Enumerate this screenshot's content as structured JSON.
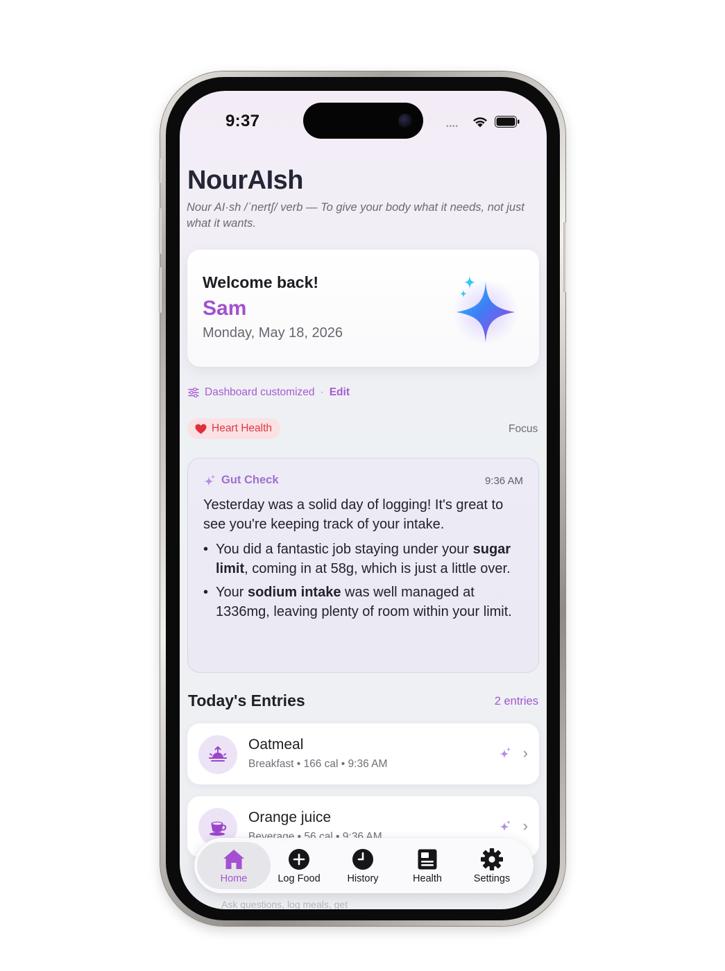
{
  "status_bar": {
    "time": "9:37",
    "signal": "••••",
    "icons": [
      "signal-icon",
      "wifi-icon",
      "battery-icon"
    ]
  },
  "header": {
    "title": "NourAIsh",
    "tagline": "Nour AI·sh /ˈnertʃ/ verb — To give your body what it needs, not just what it wants."
  },
  "welcome": {
    "greeting": "Welcome back!",
    "name": "Sam",
    "date": "Monday, May 18, 2026",
    "icon": "sparkle-icon"
  },
  "dashboard": {
    "status": "Dashboard customized",
    "separator": "·",
    "edit_label": "Edit"
  },
  "focus": {
    "chip_label": "Heart Health",
    "label": "Focus"
  },
  "gut_check": {
    "title": "Gut Check",
    "time": "9:36 AM",
    "intro": "Yesterday was a solid day of logging! It's great to see you're keeping track of your intake.",
    "bullets": [
      {
        "pre": "You did a fantastic job staying under your ",
        "bold": "sugar limit",
        "post": ", coming in at 58g, which is just a little over."
      },
      {
        "pre": "Your ",
        "bold": "sodium intake",
        "post": " was well managed at 1336mg, leaving plenty of room within your limit."
      }
    ]
  },
  "entries": {
    "title": "Today's Entries",
    "count": "2 entries",
    "items": [
      {
        "name": "Oatmeal",
        "meta": "Breakfast  •  166 cal  •  9:36 AM",
        "icon": "sunrise-icon"
      },
      {
        "name": "Orange juice",
        "meta": "Beverage  •  56 cal  •  9:36 AM",
        "icon": "cup-icon"
      }
    ]
  },
  "tab_bar": {
    "tabs": [
      {
        "label": "Home",
        "icon": "house-icon",
        "active": true
      },
      {
        "label": "Log Food",
        "icon": "plus-circle-icon",
        "active": false
      },
      {
        "label": "History",
        "icon": "clock-icon",
        "active": false
      },
      {
        "label": "Health",
        "icon": "health-card-icon",
        "active": false
      },
      {
        "label": "Settings",
        "icon": "gear-icon",
        "active": false
      }
    ]
  },
  "chat_peek": "Ask questions, log meals, get",
  "colors": {
    "accent": "#a350cf",
    "heart": "#d93a44",
    "heart_bg": "#fbe1e3",
    "title": "#232635"
  }
}
